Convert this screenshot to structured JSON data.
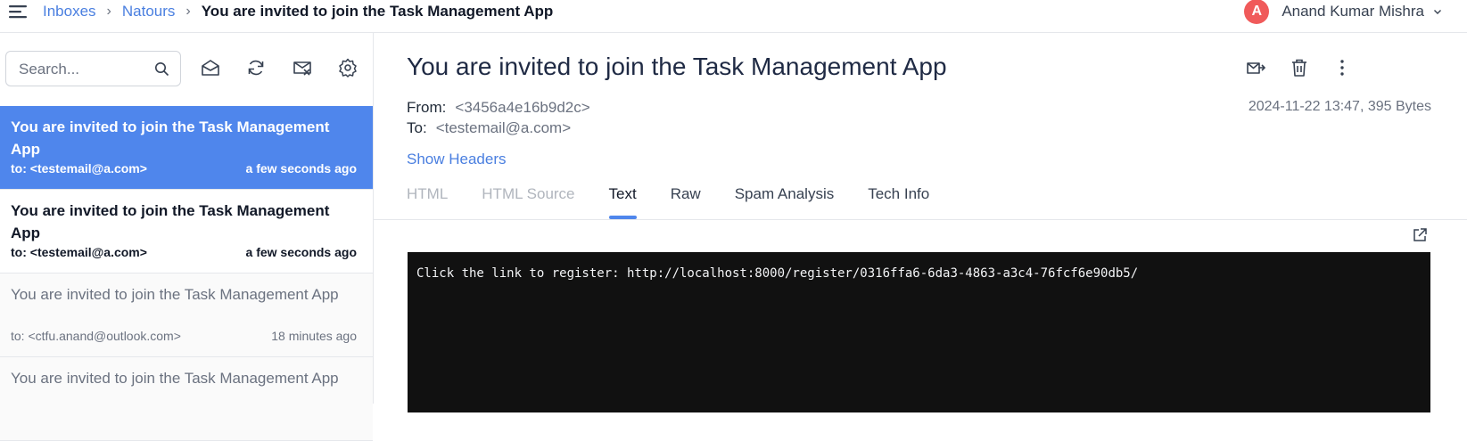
{
  "breadcrumb": {
    "items": [
      "Inboxes",
      "Natours"
    ],
    "current": "You are invited to join the Task Management App"
  },
  "user": {
    "initial": "A",
    "name": "Anand Kumar Mishra"
  },
  "search": {
    "placeholder": "Search..."
  },
  "messages": [
    {
      "subject": "You are invited to join the Task Management App",
      "to": "to: <testemail@a.com>",
      "time": "a few seconds ago",
      "state": "selected"
    },
    {
      "subject": "You are invited to join the Task Management App",
      "to": "to: <testemail@a.com>",
      "time": "a few seconds ago",
      "state": "unread"
    },
    {
      "subject": "You are invited to join the Task Management App",
      "to": "to: <ctfu.anand@outlook.com>",
      "time": "18 minutes ago",
      "state": "read"
    },
    {
      "subject": "You are invited to join the Task Management App",
      "to": "",
      "time": "",
      "state": "read"
    }
  ],
  "mail": {
    "title": "You are invited to join the Task Management App",
    "from_label": "From:",
    "from_value": "<3456a4e16b9d2c>",
    "to_label": "To:",
    "to_value": "<testemail@a.com>",
    "date_size": "2024-11-22 13:47, 395 Bytes",
    "show_headers": "Show Headers",
    "tabs": [
      "HTML",
      "HTML Source",
      "Text",
      "Raw",
      "Spam Analysis",
      "Tech Info"
    ],
    "active_tab": "Text",
    "body_text": "Click the link to register: http://localhost:8000/register/0316ffa6-6da3-4863-a3c4-76fcf6e90db5/"
  },
  "colors": {
    "accent": "#4f86ec",
    "avatar": "#f05a5a",
    "link": "#4a7fe0"
  }
}
